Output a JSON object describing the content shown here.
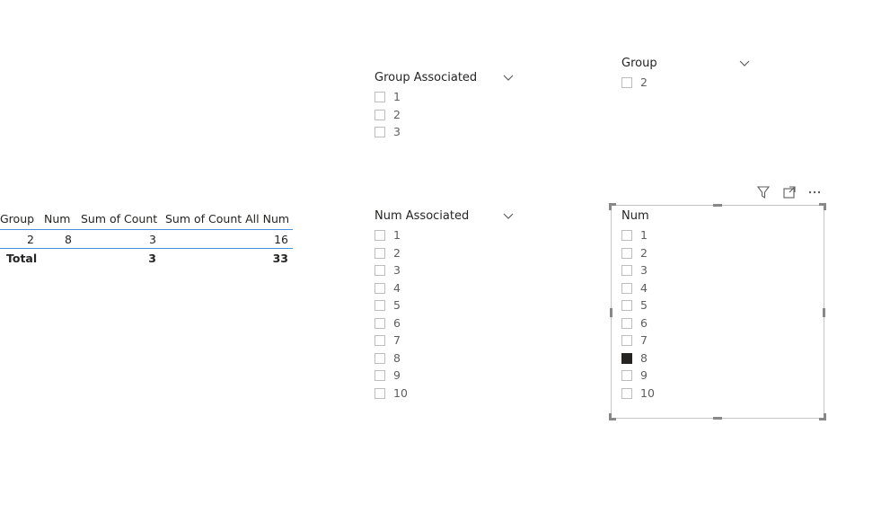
{
  "table": {
    "headers": [
      "Group",
      "Num",
      "Sum of Count",
      "Sum of Count All Num"
    ],
    "rows": [
      [
        "2",
        "8",
        "3",
        "16"
      ]
    ],
    "total": {
      "label": "Total",
      "sum_count": "3",
      "sum_count_all": "33"
    }
  },
  "group_associated": {
    "title": "Group Associated",
    "items": [
      "1",
      "2",
      "3"
    ]
  },
  "group": {
    "title": "Group",
    "items": [
      "2"
    ]
  },
  "num_associated": {
    "title": "Num Associated",
    "items": [
      "1",
      "2",
      "3",
      "4",
      "5",
      "6",
      "7",
      "8",
      "9",
      "10"
    ]
  },
  "num": {
    "title": "Num",
    "items": [
      "1",
      "2",
      "3",
      "4",
      "5",
      "6",
      "7",
      "8",
      "9",
      "10"
    ],
    "selected": "8"
  },
  "toolbar": {
    "icons": [
      "filter-icon",
      "focus-mode-icon",
      "more-options-icon"
    ]
  },
  "colors": {
    "accent_line": "#4a90d9",
    "checked": "#252423"
  }
}
